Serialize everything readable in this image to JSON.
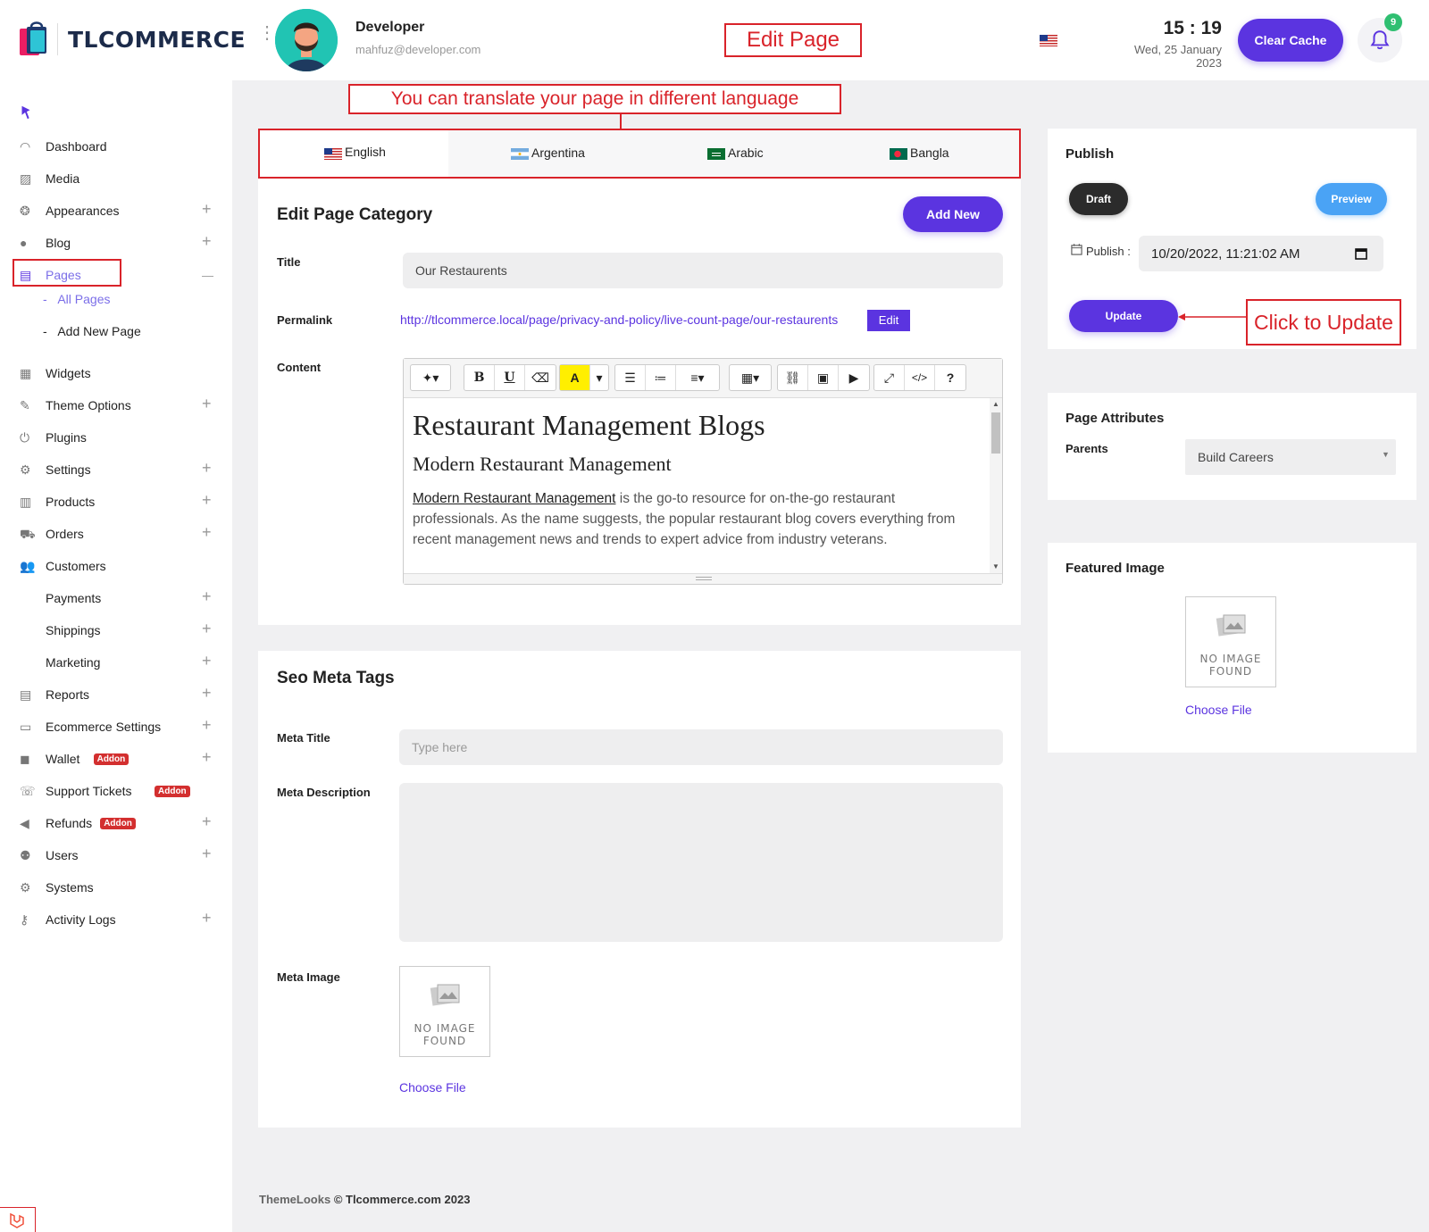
{
  "header": {
    "logo_text": "TLCOMMERCE",
    "user_name": "Developer",
    "user_email": "mahfuz@developer.com",
    "annotation_edit_page": "Edit Page",
    "time": "15 : 19",
    "date": "Wed, 25 January 2023",
    "clear_cache_label": "Clear Cache",
    "notification_count": "9"
  },
  "sidebar": {
    "items": [
      {
        "label": "Dashboard",
        "icon": "dashboard-icon",
        "plus": false
      },
      {
        "label": "Media",
        "icon": "media-icon",
        "plus": false
      },
      {
        "label": "Appearances",
        "icon": "appearances-icon",
        "plus": true
      },
      {
        "label": "Blog",
        "icon": "blog-icon",
        "plus": true
      },
      {
        "label": "Pages",
        "icon": "pages-icon",
        "plus": false,
        "minus": true,
        "active": true
      },
      {
        "label": "Widgets",
        "icon": "widgets-icon",
        "plus": false
      },
      {
        "label": "Theme Options",
        "icon": "brush-icon",
        "plus": true
      },
      {
        "label": "Plugins",
        "icon": "plugin-icon",
        "plus": false
      },
      {
        "label": "Settings",
        "icon": "gears-icon",
        "plus": true
      },
      {
        "label": "Products",
        "icon": "products-icon",
        "plus": true
      },
      {
        "label": "Orders",
        "icon": "cart-icon",
        "plus": true
      },
      {
        "label": "Customers",
        "icon": "customers-icon",
        "plus": false
      },
      {
        "label": "Payments",
        "icon": "",
        "plus": true
      },
      {
        "label": "Shippings",
        "icon": "",
        "plus": true
      },
      {
        "label": "Marketing",
        "icon": "",
        "plus": true
      },
      {
        "label": "Reports",
        "icon": "reports-icon",
        "plus": true
      },
      {
        "label": "Ecommerce Settings",
        "icon": "window-icon",
        "plus": true
      },
      {
        "label": "Wallet",
        "icon": "wallet-icon",
        "plus": true,
        "addon": "Addon"
      },
      {
        "label": "Support Tickets",
        "icon": "support-icon",
        "plus": false,
        "addon": "Addon"
      },
      {
        "label": "Refunds",
        "icon": "refund-icon",
        "plus": true,
        "addon": "Addon"
      },
      {
        "label": "Users",
        "icon": "users-icon",
        "plus": true
      },
      {
        "label": "Systems",
        "icon": "gear-icon",
        "plus": false
      },
      {
        "label": "Activity Logs",
        "icon": "key-icon",
        "plus": true
      }
    ],
    "sub_all_pages": "All Pages",
    "sub_add_new_page": "Add New Page",
    "sub_prefix": "-"
  },
  "translate": {
    "annotation": "You can translate your page in different language",
    "tabs": [
      "English",
      "Argentina",
      "Arabic",
      "Bangla"
    ]
  },
  "edit_card": {
    "title": "Edit Page Category",
    "add_new_label": "Add New",
    "title_label": "Title",
    "title_value": "Our Restaurents",
    "permalink_label": "Permalink",
    "permalink_url": "http://tlcommerce.local/page/privacy-and-policy/live-count-page/our-restaurents",
    "permalink_edit": "Edit",
    "content_label": "Content",
    "content": {
      "h1": "Restaurant Management Blogs",
      "h2": "Modern Restaurant Management",
      "p_link": "Modern Restaurant Management",
      "p_rest": " is the go-to resource for on-the-go restaurant professionals. As the name suggests, the popular restaurant blog covers everything from recent management news and trends to expert advice from industry veterans."
    }
  },
  "seo_card": {
    "title": "Seo Meta Tags",
    "meta_title_label": "Meta Title",
    "meta_title_placeholder": "Type here",
    "meta_description_label": "Meta Description",
    "meta_image_label": "Meta Image",
    "no_image_line1": "NO IMAGE",
    "no_image_line2": "FOUND",
    "choose_file": "Choose File"
  },
  "publish_card": {
    "title": "Publish",
    "draft_label": "Draft",
    "preview_label": "Preview",
    "publish_label": "Publish :",
    "publish_value": "10/20/2022, 11:21:02 AM",
    "update_label": "Update",
    "annotation_update": "Click to Update"
  },
  "attributes_card": {
    "title": "Page Attributes",
    "parents_label": "Parents",
    "parents_value": "Build Careers"
  },
  "featured_card": {
    "title": "Featured Image",
    "no_image_line1": "NO IMAGE",
    "no_image_line2": "FOUND",
    "choose_file": "Choose File"
  },
  "footer": {
    "brand": "ThemeLooks",
    "copyright": "© Tlcommerce.com 2023"
  },
  "colors": {
    "accent": "#5b34e0",
    "annotation": "#d9232a",
    "preview": "#4aa3f5",
    "draft": "#2b2b2b"
  }
}
